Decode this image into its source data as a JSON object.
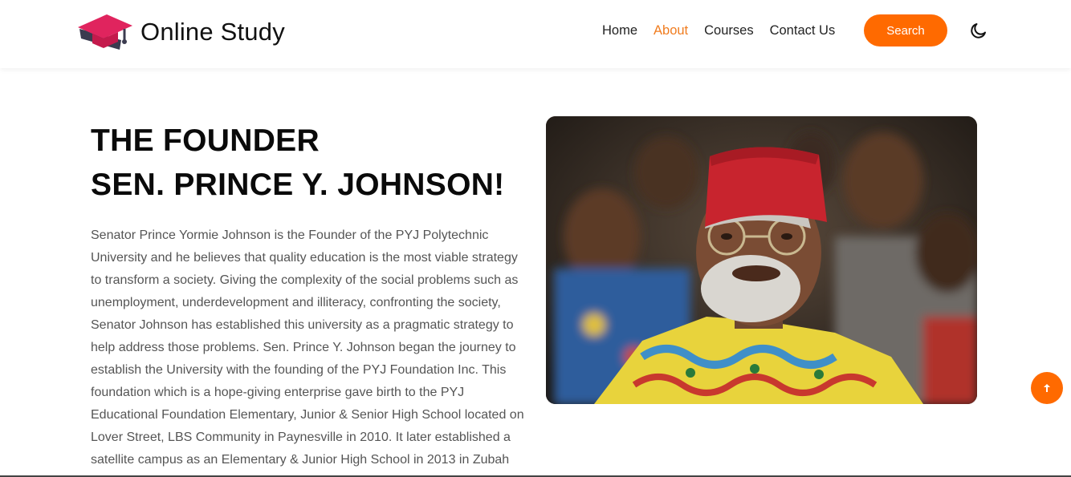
{
  "brand": {
    "name": "Online Study",
    "logo_icon": "graduation-cap-icon"
  },
  "nav": {
    "items": [
      {
        "label": "Home",
        "active": false
      },
      {
        "label": "About",
        "active": true
      },
      {
        "label": "Courses",
        "active": false
      },
      {
        "label": "Contact Us",
        "active": false
      }
    ],
    "search_label": "Search",
    "theme_icon": "moon-icon"
  },
  "founder": {
    "heading_line1": "THE FOUNDER",
    "heading_line2": "SEN. PRINCE Y. JOHNSON!",
    "paragraph": "Senator Prince Yormie Johnson is the Founder of the PYJ Polytechnic University and he believes that quality education is the most viable strategy to transform a society. Giving the complexity of the social problems such as unemployment, underdevelopment and illiteracy, confronting the society, Senator Johnson has established this university as a pragmatic strategy to help address those problems. Sen. Prince Y. Johnson began the journey to establish the University with the founding of the PYJ Foundation Inc. This foundation which is a hope-giving enterprise gave birth to the PYJ Educational Foundation Elementary, Junior & Senior High School located on Lover Street, LBS Community in Paynesville in 2010. It later established a satellite campus as an Elementary & Junior High School in 2013 in Zubah Town, Duport Road, Paynesville. Touching humanity from a secondary",
    "photo_icon": "founder-photo"
  },
  "scroll_top_icon": "arrow-up-icon",
  "colors": {
    "accent": "#ff6a00",
    "active_link": "#f07c1f",
    "heading": "#0a0a0a",
    "body_text": "#555555"
  }
}
